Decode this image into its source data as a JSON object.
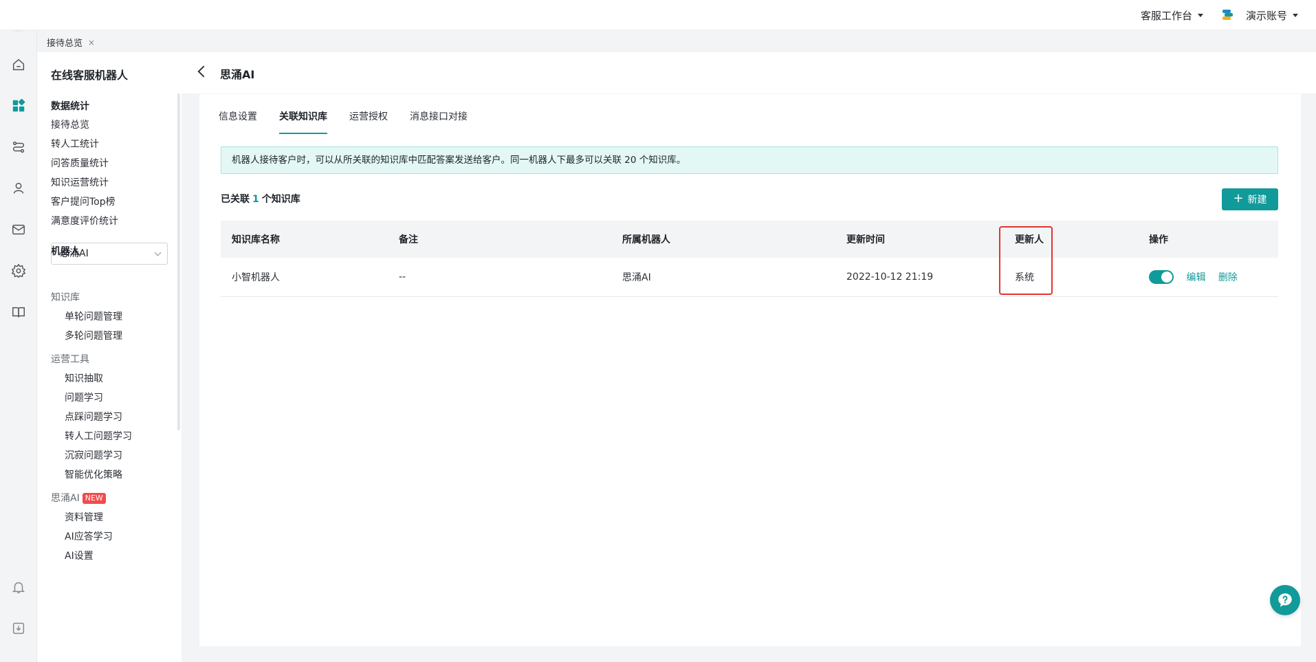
{
  "topbar": {
    "workbench_label": "客服工作台",
    "account_label": "演示账号"
  },
  "tagbar": {
    "tab_label": "接待总览",
    "close_glyph": "×"
  },
  "sidenav": {
    "title": "在线客服机器人",
    "stats_section": "数据统计",
    "stats_items": [
      "接待总览",
      "转人工统计",
      "问答质量统计",
      "知识运营统计",
      "客户提问Top榜",
      "满意度评价统计"
    ],
    "robot_section": "机器人",
    "robot_selected": "思涌AI",
    "kb_group": "知识库",
    "kb_items": [
      "单轮问题管理",
      "多轮问题管理"
    ],
    "ops_group": "运营工具",
    "ops_items": [
      "知识抽取",
      "问题学习",
      "点踩问题学习",
      "转人工问题学习",
      "沉寂问题学习",
      "智能优化策略"
    ],
    "ai_group": "思涌AI",
    "ai_badge": "NEW",
    "ai_items": [
      "资料管理",
      "AI应答学习",
      "AI设置"
    ]
  },
  "page": {
    "title": "思涌AI",
    "tabs": [
      "信息设置",
      "关联知识库",
      "运营授权",
      "消息接口对接"
    ],
    "active_tab": "关联知识库",
    "notice": "机器人接待客户时，可以从所关联的知识库中匹配答案发送给客户。同一机器人下最多可以关联 20 个知识库。",
    "count_prefix": "已关联",
    "count_value": "1",
    "count_suffix": "个知识库",
    "new_button": "新建"
  },
  "table": {
    "columns": [
      "知识库名称",
      "备注",
      "所属机器人",
      "更新时间",
      "更新人",
      "操作"
    ],
    "rows": [
      {
        "name": "小智机器人",
        "remark": "--",
        "robot": "思涌AI",
        "updated_at": "2022-10-12 21:19",
        "updater": "系统",
        "enabled": true,
        "edit": "编辑",
        "delete": "删除"
      }
    ]
  },
  "colors": {
    "accent": "#119a9a",
    "highlight_box": "#e3342f",
    "badge": "#f04c4c"
  },
  "icons": {
    "rail": [
      "home-icon",
      "dashboard-icon",
      "route-icon",
      "user-icon",
      "mail-icon",
      "settings-icon",
      "book-icon",
      "bell-icon",
      "download-icon"
    ],
    "help": "help-icon"
  }
}
